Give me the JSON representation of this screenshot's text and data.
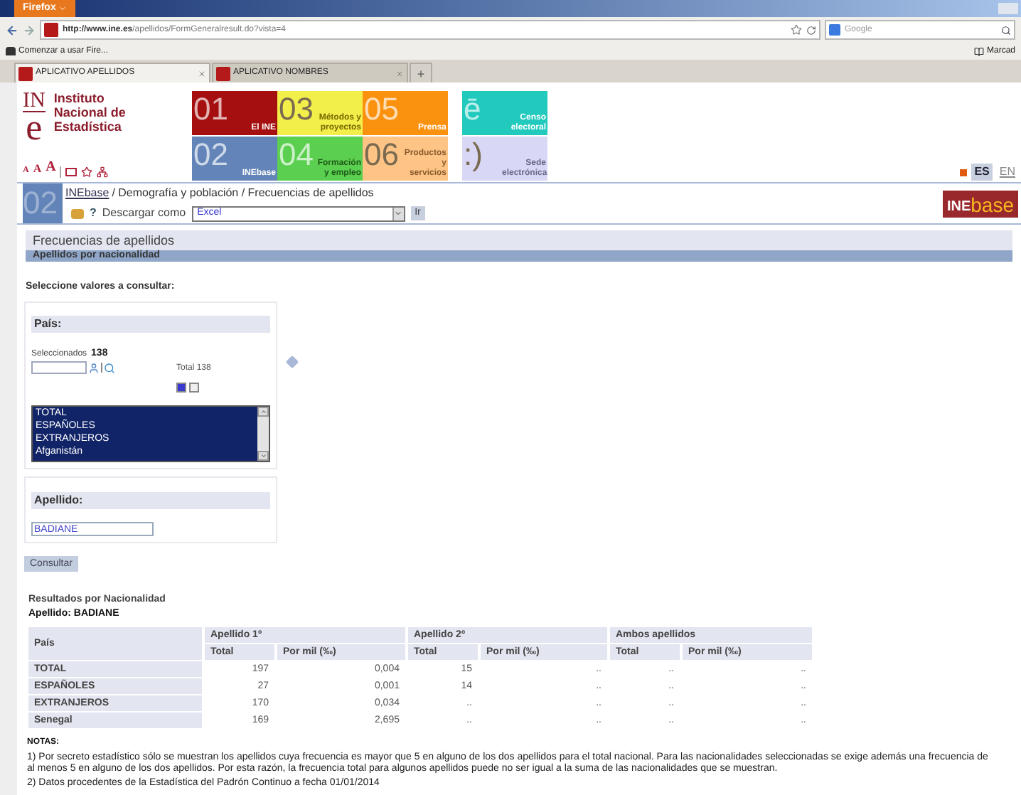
{
  "browser": {
    "menu_button": "Firefox",
    "url_host": "http://www.ine.es",
    "url_path": "/apellidos/FormGeneralresult.do?vista=4",
    "search_placeholder": "Google",
    "bookmark": "Comenzar a usar Fire...",
    "bookmarks_menu": "Marcad",
    "tabs": [
      {
        "label": "APLICATIVO APELLIDOS",
        "selected": true
      },
      {
        "label": "APLICATIVO NOMBRES",
        "selected": false
      }
    ],
    "new_tab": "+"
  },
  "header": {
    "logo_mark_top": "IN",
    "logo_mark_bottom": "e",
    "logo_lines": [
      "Instituto",
      "Nacional de",
      "Estadística"
    ],
    "text_sizes": [
      "A",
      "A",
      "A"
    ],
    "tiles": [
      {
        "number": "01",
        "label": "El INE",
        "color": "#a50f0f"
      },
      {
        "number": "02",
        "label": "INEbase",
        "color": "#6384b8"
      },
      {
        "number": "03",
        "label": "Métodos y proyectos",
        "color": "#f2ee4a"
      },
      {
        "number": "04",
        "label": "Formación y empleo",
        "color": "#5bcf4f"
      },
      {
        "number": "05",
        "label": "Prensa",
        "color": "#fb920f"
      },
      {
        "number": "06",
        "label": "Productos y servicios",
        "color": "#fdc486"
      },
      {
        "number": "ē",
        "label": "Censo electoral",
        "color": "#22c9bd"
      },
      {
        "number": ":)",
        "label": "Sede electrónica",
        "color": "#d8d8f6"
      }
    ],
    "languages": [
      {
        "label": "ES",
        "selected": true
      },
      {
        "label": "EN",
        "selected": false
      }
    ]
  },
  "breadcrumb": {
    "section_number": "02",
    "link": "INEbase",
    "path": "/ Demografía y población / Frecuencias de apellidos",
    "help": "?",
    "download_label": "Descargar como",
    "download_value": "Excel",
    "go_button": "Ir",
    "logo_ine": "INE",
    "logo_base": "base"
  },
  "page": {
    "title": "Frecuencias de apellidos",
    "subtitle": "Apellidos por nacionalidad",
    "prompt": "Seleccione valores a consultar:"
  },
  "country_panel": {
    "heading": "País:",
    "selected_label": "Seleccionados",
    "selected_count": "138",
    "total_label": "Total 138",
    "options": [
      {
        "label": "TOTAL",
        "selected": true
      },
      {
        "label": "ESPAÑOLES",
        "selected": true
      },
      {
        "label": "EXTRANJEROS",
        "selected": true
      },
      {
        "label": "Afganistán",
        "selected": true
      }
    ]
  },
  "surname_panel": {
    "heading": "Apellido:",
    "value": "BADIANE"
  },
  "consult_button": "Consultar",
  "results": {
    "title": "Resultados por Nacionalidad",
    "surname": "Apellido: BADIANE",
    "corner_header": "País",
    "groups": [
      "Apellido 1º",
      "Apellido 2º",
      "Ambos apellidos"
    ],
    "subheaders": [
      "Total",
      "Por mil (‰)",
      "Total",
      "Por mil (‰)",
      "Total",
      "Por mil (‰)"
    ],
    "rows": [
      {
        "label": "TOTAL",
        "cells": [
          "197",
          "0,004",
          "15",
          "..",
          "..",
          ".."
        ]
      },
      {
        "label": "ESPAÑOLES",
        "cells": [
          "27",
          "0,001",
          "14",
          "..",
          "..",
          ".."
        ]
      },
      {
        "label": "EXTRANJEROS",
        "cells": [
          "170",
          "0,034",
          "..",
          "..",
          "..",
          ".."
        ]
      },
      {
        "label": "Senegal",
        "cells": [
          "169",
          "2,695",
          "..",
          "..",
          "..",
          ".."
        ]
      }
    ]
  },
  "notes": {
    "title": "NOTAS:",
    "items": [
      "1) Por secreto estadístico sólo se muestran los apellidos cuya frecuencia es mayor que 5 en alguno de los dos apellidos para el total nacional. Para las nacionalidades seleccionadas se exige además una frecuencia de al menos 5 en alguno de los dos apellidos. Por esta razón, la frecuencia total para algunos apellidos puede no ser igual a la suma de las nacionalidades que se muestran.",
      "2) Datos procedentes de la Estadística del Padrón Continuo a fecha 01/01/2014"
    ]
  }
}
